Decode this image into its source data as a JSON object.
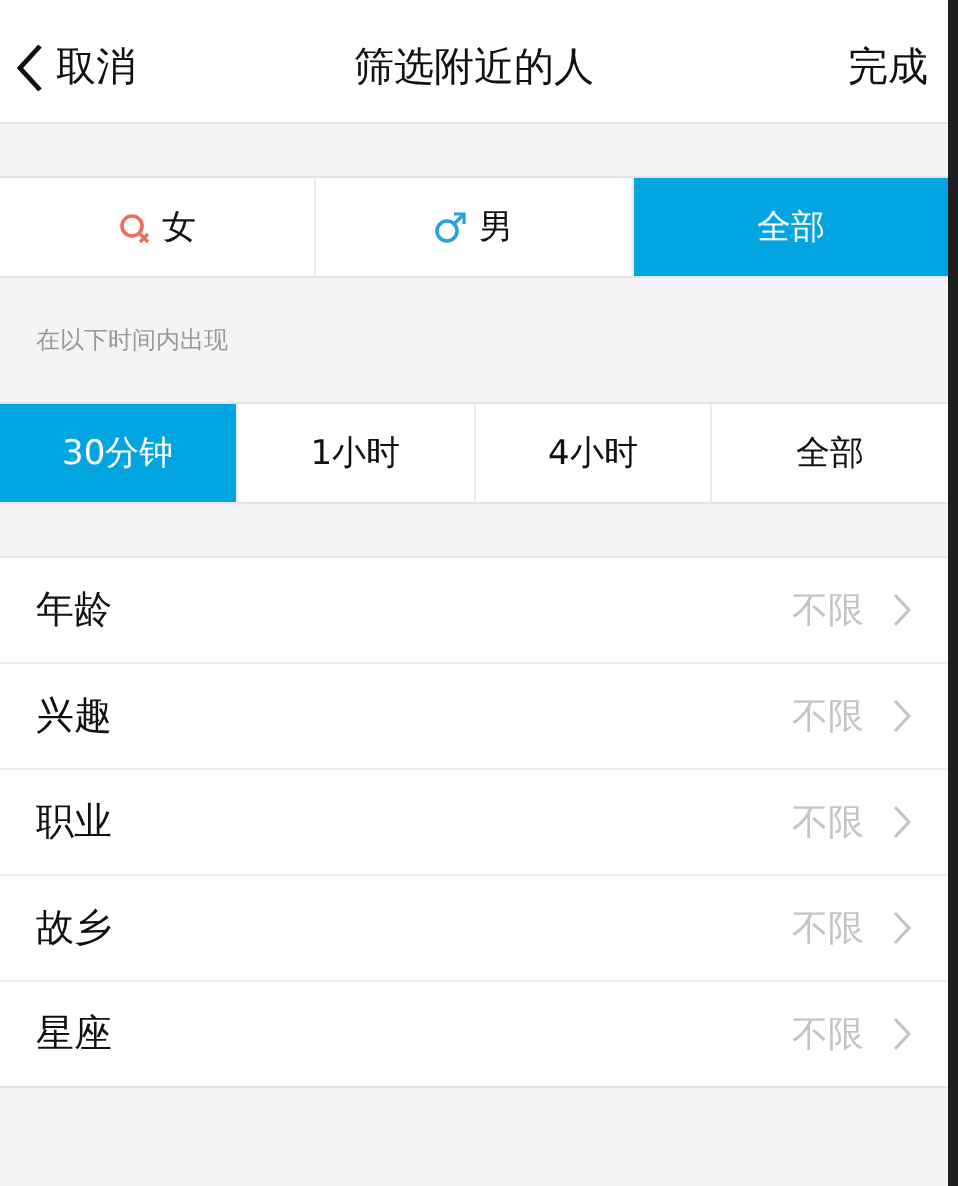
{
  "nav": {
    "back": "取消",
    "title": "筛选附近的人",
    "done": "完成"
  },
  "gender_tabs": [
    {
      "label": "女",
      "kind": "female",
      "selected": false
    },
    {
      "label": "男",
      "kind": "male",
      "selected": false
    },
    {
      "label": "全部",
      "kind": "all",
      "selected": true
    }
  ],
  "time_caption": "在以下时间内出现",
  "time_tabs": [
    {
      "label": "30分钟",
      "selected": true
    },
    {
      "label": "1小时",
      "selected": false
    },
    {
      "label": "4小时",
      "selected": false
    },
    {
      "label": "全部",
      "selected": false
    }
  ],
  "filters": [
    {
      "label": "年龄",
      "value": "不限"
    },
    {
      "label": "兴趣",
      "value": "不限"
    },
    {
      "label": "职业",
      "value": "不限"
    },
    {
      "label": "故乡",
      "value": "不限"
    },
    {
      "label": "星座",
      "value": "不限"
    }
  ]
}
